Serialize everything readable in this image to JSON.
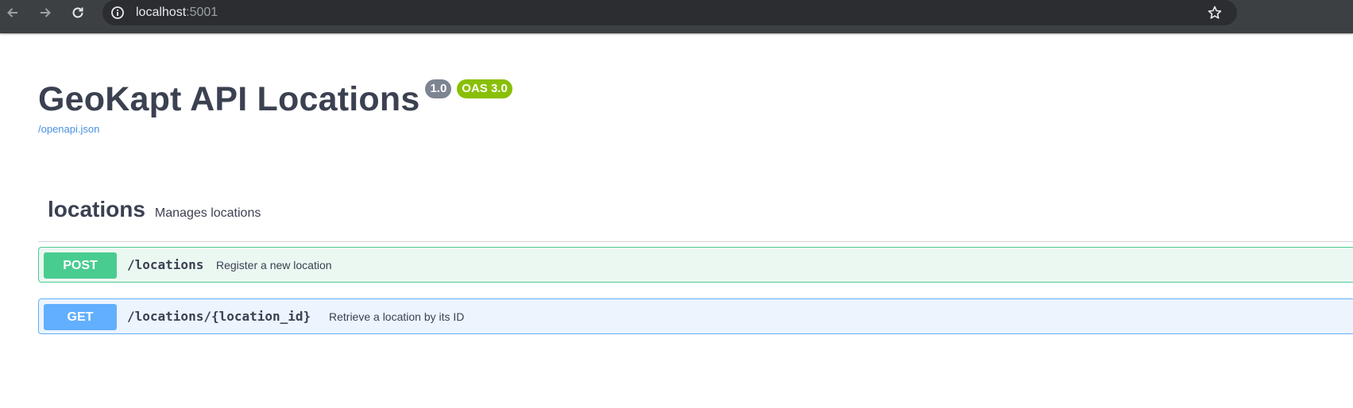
{
  "browser": {
    "url_host": "localhost",
    "url_port": ":5001"
  },
  "info": {
    "title": "GeoKapt API Locations",
    "version_badge": "1.0",
    "oas_badge": "OAS 3.0",
    "spec_link": "/openapi.json"
  },
  "tag": {
    "name": "locations",
    "description": "Manages locations"
  },
  "operations": [
    {
      "method": "POST",
      "path": "/locations",
      "summary": "Register a new location"
    },
    {
      "method": "GET",
      "path": "/locations/{location_id}",
      "summary": "Retrieve a location by its ID"
    }
  ],
  "colors": {
    "post": "#49cc90",
    "get": "#61affe",
    "oas_badge": "#89bf04",
    "version_badge": "#7d8492",
    "link": "#4990e2",
    "text": "#3b4151"
  },
  "icons": {
    "back": "arrow-left-icon",
    "forward": "arrow-right-icon",
    "reload": "reload-icon",
    "site_info": "info-icon",
    "bookmark": "star-icon"
  }
}
